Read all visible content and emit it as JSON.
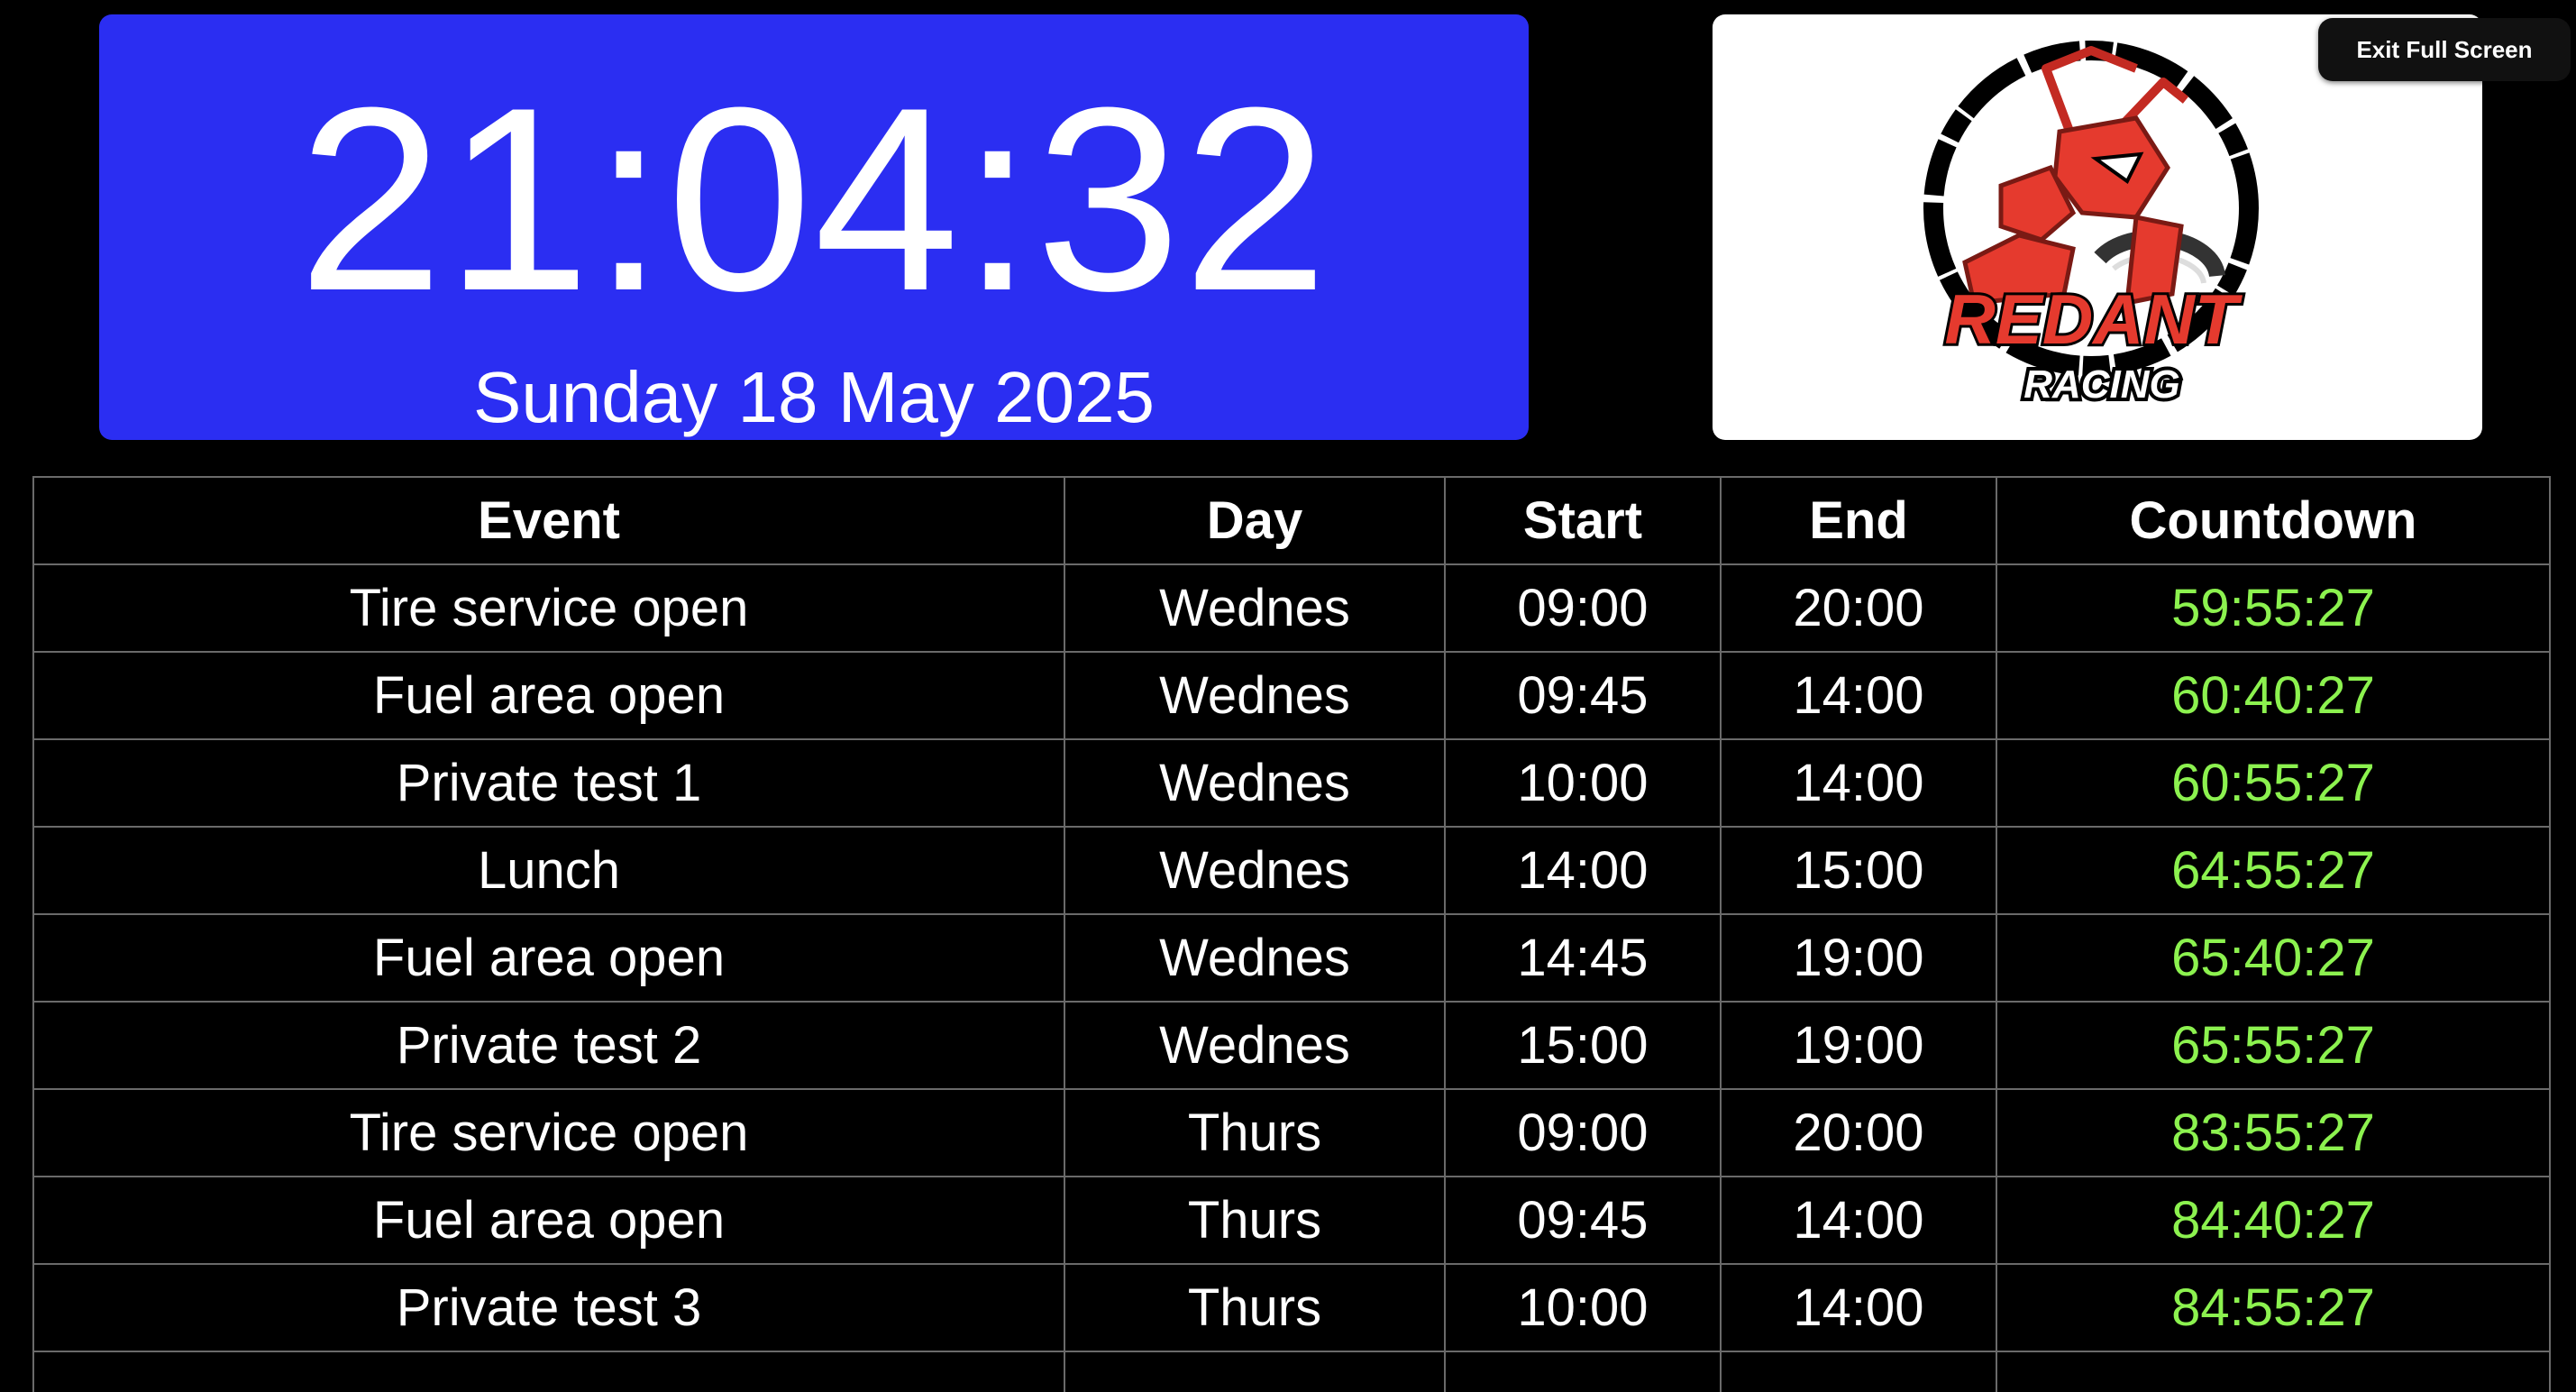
{
  "clock": {
    "time": "21:04:32",
    "date": "Sunday 18 May 2025"
  },
  "logo": {
    "brand_top": "REDANT",
    "brand_bottom": "RACING"
  },
  "controls": {
    "exit_fullscreen_label": "Exit Full Screen"
  },
  "colors": {
    "clock_background": "#2b2ef2",
    "countdown_text": "#8cf24f",
    "logo_red": "#e53a2e"
  },
  "table": {
    "headers": [
      "Event",
      "Day",
      "Start",
      "End",
      "Countdown"
    ],
    "rows": [
      [
        "Tire service open",
        "Wednes",
        "09:00",
        "20:00",
        "59:55:27"
      ],
      [
        "Fuel area open",
        "Wednes",
        "09:45",
        "14:00",
        "60:40:27"
      ],
      [
        "Private test 1",
        "Wednes",
        "10:00",
        "14:00",
        "60:55:27"
      ],
      [
        "Lunch",
        "Wednes",
        "14:00",
        "15:00",
        "64:55:27"
      ],
      [
        "Fuel area open",
        "Wednes",
        "14:45",
        "19:00",
        "65:40:27"
      ],
      [
        "Private test 2",
        "Wednes",
        "15:00",
        "19:00",
        "65:55:27"
      ],
      [
        "Tire service open",
        "Thurs",
        "09:00",
        "20:00",
        "83:55:27"
      ],
      [
        "Fuel area open",
        "Thurs",
        "09:45",
        "14:00",
        "84:40:27"
      ],
      [
        "Private test 3",
        "Thurs",
        "10:00",
        "14:00",
        "84:55:27"
      ]
    ]
  }
}
